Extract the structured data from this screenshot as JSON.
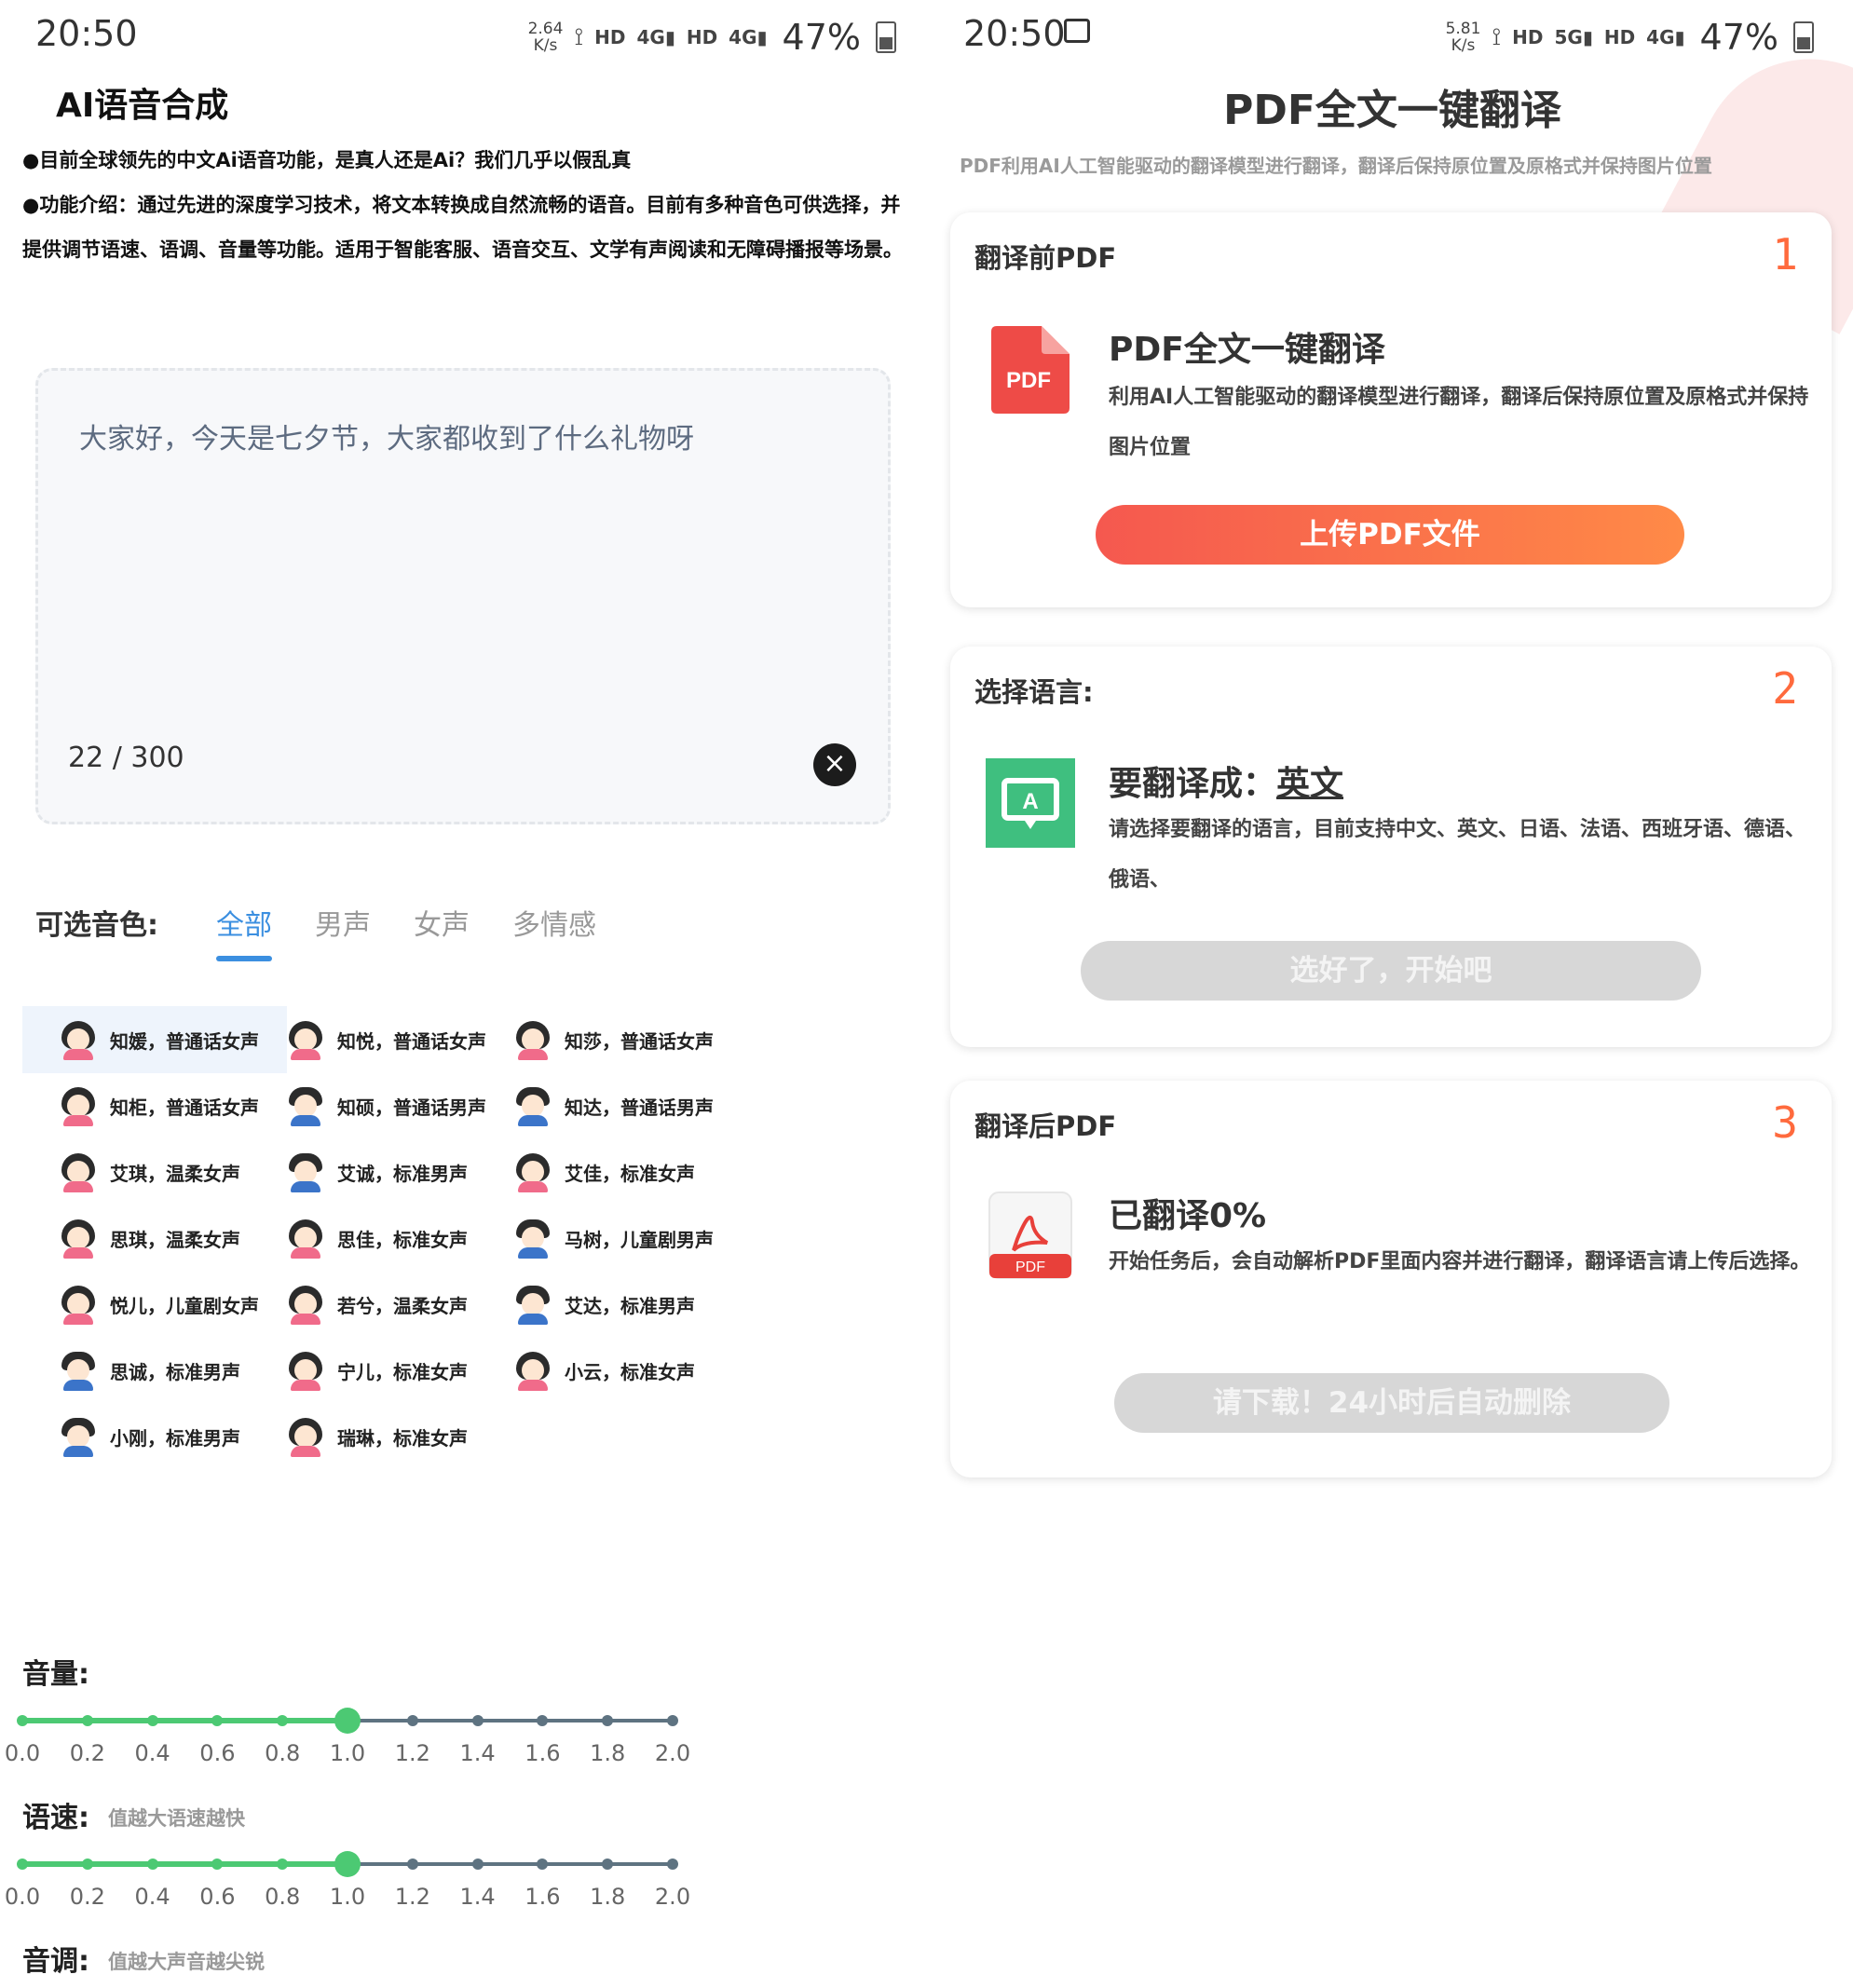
{
  "left": {
    "status": {
      "time": "20:50",
      "speed_top": "2.64",
      "speed_bottom": "K/s",
      "net1": "4G",
      "net2": "4G",
      "hd": "HD",
      "battery": "47%"
    },
    "title": "AI语音合成",
    "intro": [
      "●目前全球领先的中文Ai语音功能，是真人还是Ai？我们几乎以假乱真",
      "●功能介绍：通过先进的深度学习技术，将文本转换成自然流畅的语音。目前有多种音色可供选择，并提供调节语速、语调、音量等功能。适用于智能客服、语音交互、文学有声阅读和无障碍播报等场景。"
    ],
    "textbox": {
      "content": "大家好，今天是七夕节，大家都收到了什么礼物呀",
      "counter": "22 / 300"
    },
    "voice_label": "可选音色:",
    "voice_tabs": [
      "全部",
      "男声",
      "女声",
      "多情感"
    ],
    "voices": [
      {
        "name": "知媛，普通话女声",
        "gender": "f"
      },
      {
        "name": "知悦，普通话女声",
        "gender": "f"
      },
      {
        "name": "知莎，普通话女声",
        "gender": "f"
      },
      {
        "name": "知柜，普通话女声",
        "gender": "f"
      },
      {
        "name": "知硕，普通话男声",
        "gender": "m"
      },
      {
        "name": "知达，普通话男声",
        "gender": "m"
      },
      {
        "name": "艾琪，温柔女声",
        "gender": "f"
      },
      {
        "name": "艾诚，标准男声",
        "gender": "m"
      },
      {
        "name": "艾佳，标准女声",
        "gender": "f"
      },
      {
        "name": "思琪，温柔女声",
        "gender": "f"
      },
      {
        "name": "思佳，标准女声",
        "gender": "f"
      },
      {
        "name": "马树，儿童剧男声",
        "gender": "m"
      },
      {
        "name": "悦儿，儿童剧女声",
        "gender": "f"
      },
      {
        "name": "若兮，温柔女声",
        "gender": "f"
      },
      {
        "name": "艾达，标准男声",
        "gender": "m"
      },
      {
        "name": "思诚，标准男声",
        "gender": "m"
      },
      {
        "name": "宁儿，标准女声",
        "gender": "f"
      },
      {
        "name": "小云，标准女声",
        "gender": "f"
      },
      {
        "name": "小刚，标准男声",
        "gender": "m"
      },
      {
        "name": "瑞琳，标准女声",
        "gender": "f"
      }
    ],
    "volume": {
      "label": "音量:",
      "value": 1.0
    },
    "speed": {
      "label": "语速:",
      "hint": "值越大语速越快",
      "value": 1.0
    },
    "pitch": {
      "label": "音调:",
      "hint": "值越大声音越尖锐"
    },
    "ticks": [
      "0.0",
      "0.2",
      "0.4",
      "0.6",
      "0.8",
      "1.0",
      "1.2",
      "1.4",
      "1.6",
      "1.8",
      "2.0"
    ],
    "colors": {
      "accent": "#3b8fe0",
      "slider_fill": "#4cc973",
      "slider_track": "#5e7381"
    }
  },
  "right": {
    "status": {
      "time": "20:50",
      "speed_top": "5.81",
      "speed_bottom": "K/s",
      "net1": "5G",
      "net2": "4G",
      "hd": "HD",
      "battery": "47%"
    },
    "title": "PDF全文一键翻译",
    "subtitle": "PDF利用AI人工智能驱动的翻译模型进行翻译，翻译后保持原位置及原格式并保持图片位置",
    "card1": {
      "head": "翻译前PDF",
      "num": "1",
      "icon_label": "PDF",
      "title": "PDF全文一键翻译",
      "desc": "利用AI人工智能驱动的翻译模型进行翻译，翻译后保持原位置及原格式并保持图片位置",
      "button": "上传PDF文件"
    },
    "card2": {
      "head": "选择语言:",
      "num": "2",
      "icon_label": "A",
      "title_prefix": "要翻译成：",
      "title_lang": "英文",
      "desc": "请选择要翻译的语言，目前支持中文、英文、日语、法语、西班牙语、德语、俄语、",
      "button": "选好了，开始吧"
    },
    "card3": {
      "head": "翻译后PDF",
      "num": "3",
      "icon_label": "PDF",
      "title": "已翻译0%",
      "desc": "开始任务后，会自动解析PDF里面内容并进行翻译，翻译语言请上传后选择。",
      "button": "请下载！24小时后自动删除"
    },
    "colors": {
      "primary_start": "#f5584f",
      "primary_end": "#ff8a47",
      "step_number": "#ff6a3d"
    }
  }
}
